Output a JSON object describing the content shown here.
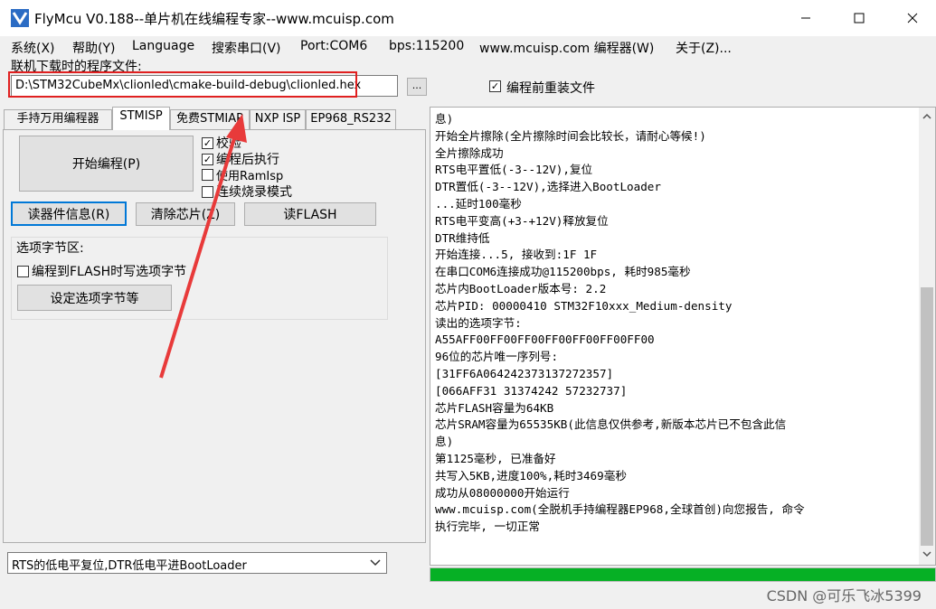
{
  "window": {
    "title": "FlyMcu V0.188--单片机在线编程专家--www.mcuisp.com",
    "minimize": "—",
    "maximize": "☐",
    "close": "✕"
  },
  "menu": {
    "items": [
      "系统(X)",
      "帮助(Y)",
      "Language",
      "搜索串口(V)",
      "Port:COM6",
      "bps:115200",
      "www.mcuisp.com 编程器(W)",
      "关于(Z)..."
    ]
  },
  "file": {
    "label": "联机下载时的程序文件:",
    "path": "D:\\STM32CubeMx\\clionled\\cmake-build-debug\\clionled.hex",
    "browse": "...",
    "reload_label": "编程前重装文件",
    "reload_checked": true
  },
  "tabs": {
    "items": [
      "手持万用编程器",
      "STMISP",
      "免费STMIAP",
      "NXP ISP",
      "EP968_RS232"
    ],
    "active": 1
  },
  "stmisp": {
    "start_button": "开始编程(P)",
    "options": [
      {
        "label": "校验",
        "checked": true
      },
      {
        "label": "编程后执行",
        "checked": true
      },
      {
        "label": "使用RamIsp",
        "checked": false
      },
      {
        "label": "连续烧录模式",
        "checked": false
      }
    ],
    "read_info_button": "读器件信息(R)",
    "erase_button": "清除芯片(Z)",
    "read_flash_button": "读FLASH",
    "option_bytes_group": "选项字节区:",
    "write_option_label": "编程到FLASH时写选项字节",
    "set_option_button": "设定选项字节等",
    "mode_select": "RTS的低电平复位,DTR低电平进BootLoader"
  },
  "log": {
    "lines": [
      "息)",
      "开始全片擦除(全片擦除时间会比较长，请耐心等候!)",
      "全片擦除成功",
      "RTS电平置低(-3--12V),复位",
      "DTR置低(-3--12V),选择进入BootLoader",
      "...延时100毫秒",
      "RTS电平变高(+3-+12V)释放复位",
      "DTR维持低",
      "开始连接...5, 接收到:1F 1F",
      "在串口COM6连接成功@115200bps, 耗时985毫秒",
      "芯片内BootLoader版本号: 2.2",
      "芯片PID: 00000410  STM32F10xxx_Medium-density",
      "读出的选项字节:",
      "A55AFF00FF00FF00FF00FF00FF00FF00",
      "96位的芯片唯一序列号:",
      "[31FF6A064242373137272357]",
      "[066AFF31 31374242 57232737]",
      "芯片FLASH容量为64KB",
      "芯片SRAM容量为65535KB(此信息仅供参考,新版本芯片已不包含此信",
      "息)",
      "第1125毫秒, 已准备好",
      "共写入5KB,进度100%,耗时3469毫秒",
      "成功从08000000开始运行",
      "www.mcuisp.com(全脱机手持编程器EP968,全球首创)向您报告, 命令",
      "执行完毕, 一切正常"
    ],
    "progress": 1.0
  },
  "watermark": "CSDN @可乐飞冰5399",
  "colors": {
    "highlight": "#e02020",
    "progress": "#06b025",
    "accent": "#0078d7"
  }
}
